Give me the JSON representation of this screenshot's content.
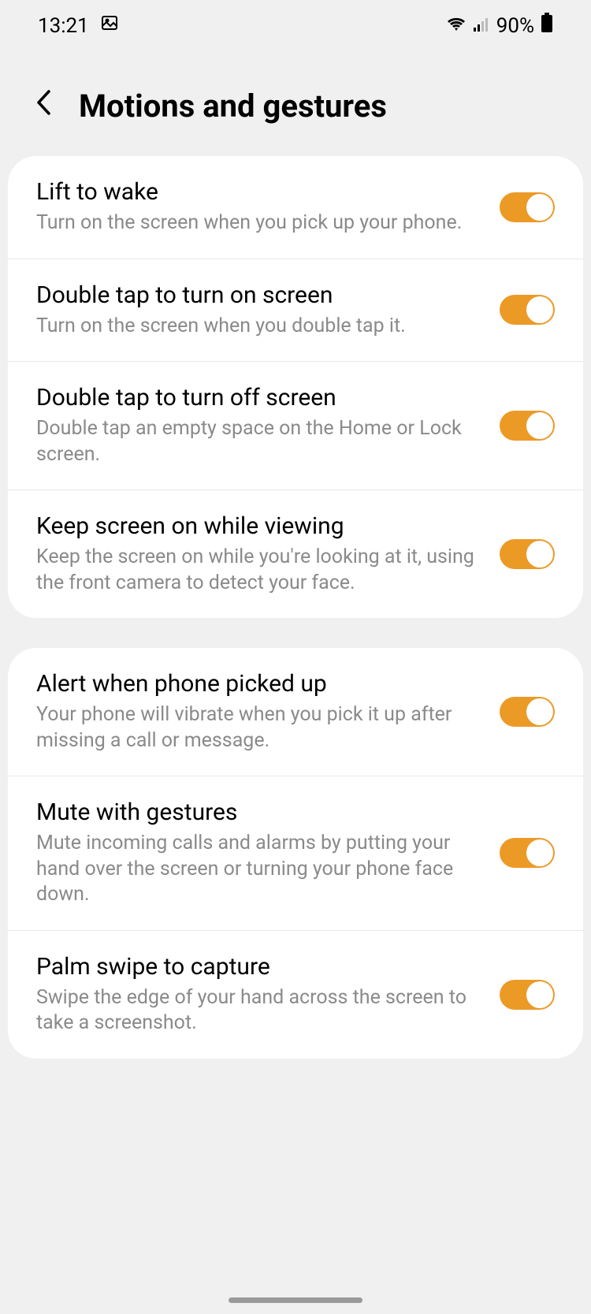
{
  "statusBar": {
    "time": "13:21",
    "battery": "90%"
  },
  "header": {
    "title": "Motions and gestures"
  },
  "groups": [
    {
      "items": [
        {
          "id": "lift-to-wake",
          "title": "Lift to wake",
          "desc": "Turn on the screen when you pick up your phone.",
          "enabled": true
        },
        {
          "id": "double-tap-on",
          "title": "Double tap to turn on screen",
          "desc": "Turn on the screen when you double tap it.",
          "enabled": true
        },
        {
          "id": "double-tap-off",
          "title": "Double tap to turn off screen",
          "desc": "Double tap an empty space on the Home or Lock screen.",
          "enabled": true
        },
        {
          "id": "keep-screen-on",
          "title": "Keep screen on while viewing",
          "desc": "Keep the screen on while you're looking at it, using the front camera to detect your face.",
          "enabled": true
        }
      ]
    },
    {
      "items": [
        {
          "id": "alert-picked-up",
          "title": "Alert when phone picked up",
          "desc": "Your phone will vibrate when you pick it up after missing a call or message.",
          "enabled": true
        },
        {
          "id": "mute-gestures",
          "title": "Mute with gestures",
          "desc": "Mute incoming calls and alarms by putting your hand over the screen or turning your phone face down.",
          "enabled": true
        },
        {
          "id": "palm-swipe",
          "title": "Palm swipe to capture",
          "desc": "Swipe the edge of your hand across the screen to take a screenshot.",
          "enabled": true
        }
      ]
    }
  ]
}
